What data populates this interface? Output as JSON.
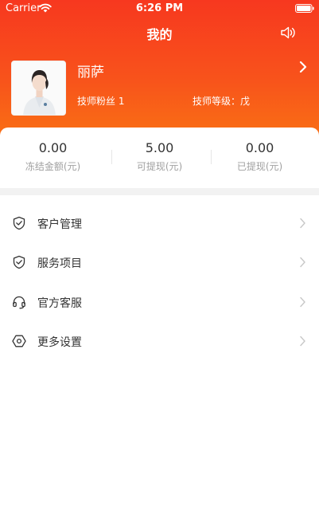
{
  "status_bar": {
    "carrier": "Carrier",
    "time": "6:26 PM"
  },
  "nav": {
    "title": "我的",
    "speaker_icon": "speaker-icon"
  },
  "profile": {
    "name": "丽萨",
    "fans": "技师粉丝 1",
    "level": "技师等级：戊"
  },
  "stats": [
    {
      "value": "0.00",
      "label": "冻结金额(元)"
    },
    {
      "value": "5.00",
      "label": "可提现(元)"
    },
    {
      "value": "0.00",
      "label": "已提现(元)"
    }
  ],
  "menu": [
    {
      "label": "客户管理",
      "icon": "shield-check-icon"
    },
    {
      "label": "服务项目",
      "icon": "shield-check-icon"
    },
    {
      "label": "官方客服",
      "icon": "headset-icon"
    },
    {
      "label": "更多设置",
      "icon": "hexagon-settings-icon"
    }
  ],
  "colors": {
    "header_top": "#f7381f",
    "header_bottom": "#fa7a12",
    "text": "#333333",
    "muted": "#a0a0a0"
  }
}
